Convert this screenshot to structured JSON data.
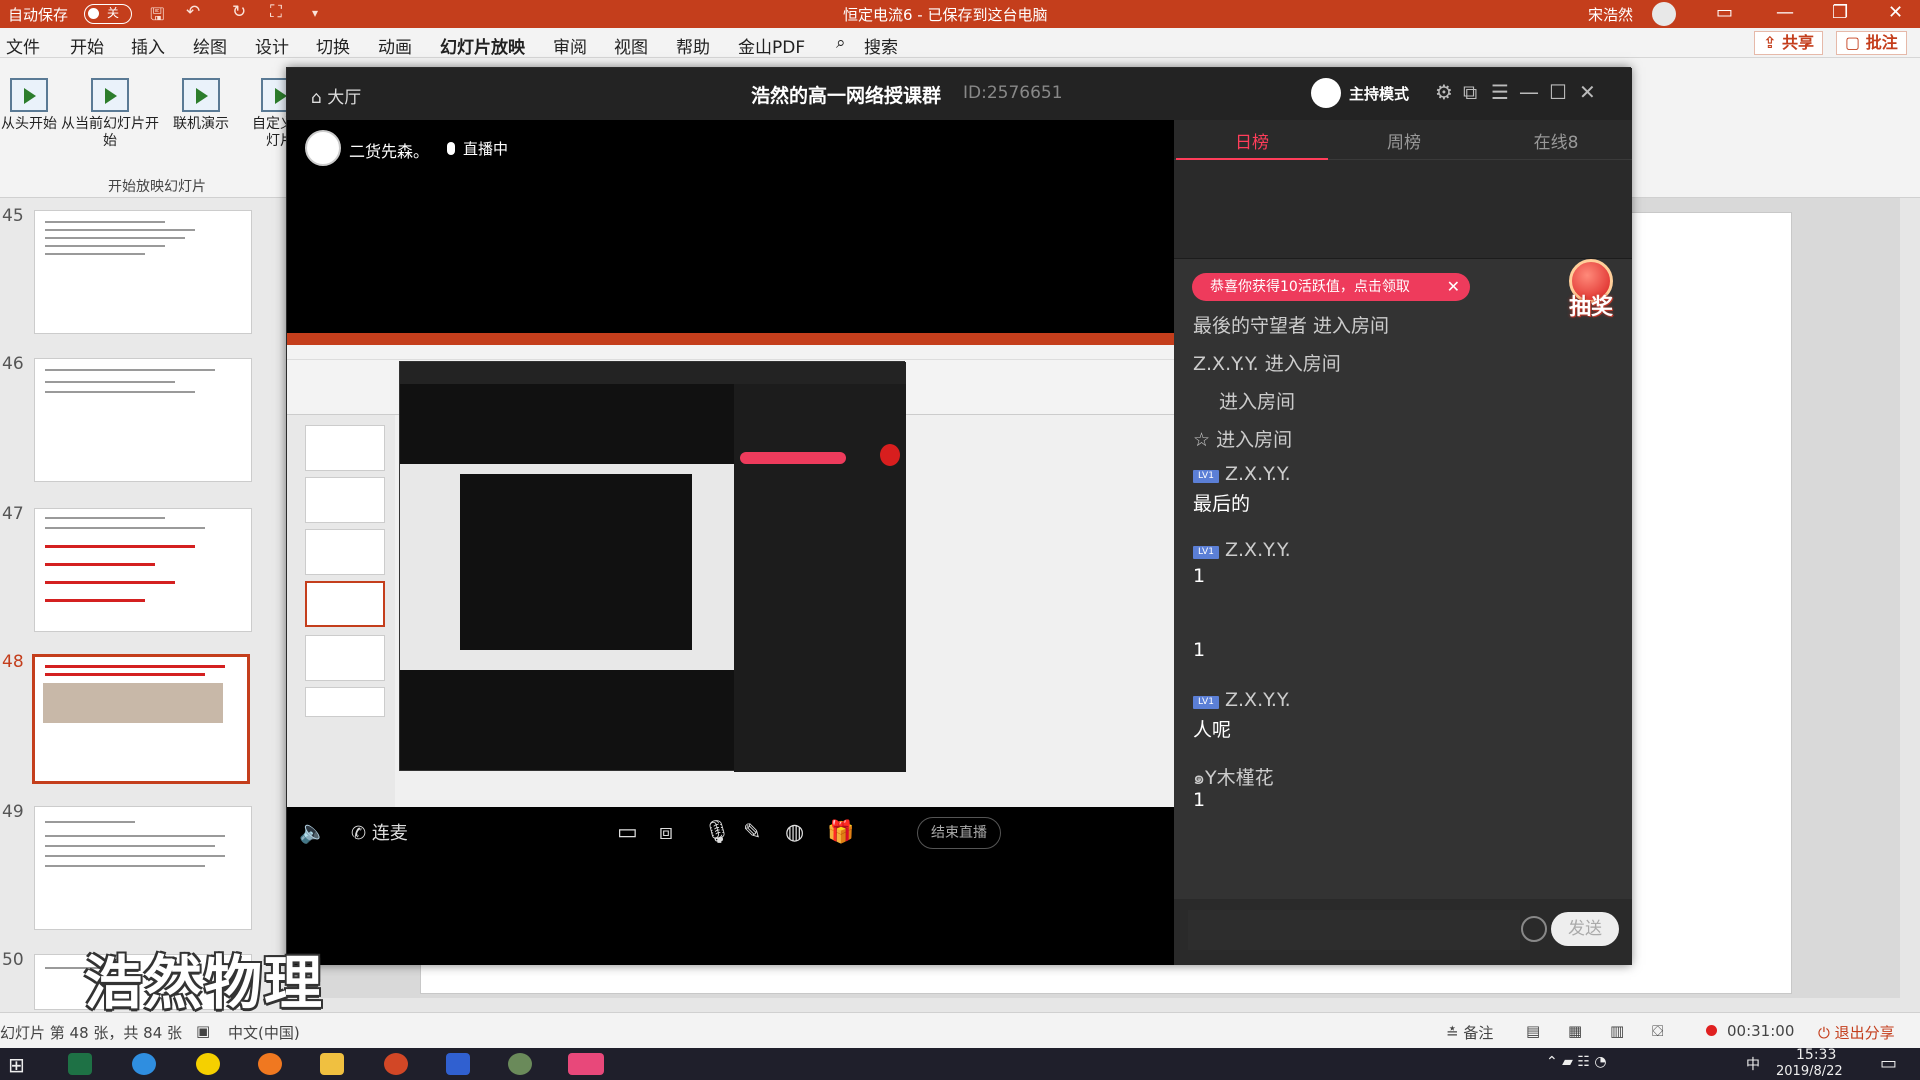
{
  "ppt": {
    "autosave_label": "自动保存",
    "autosave_state": "关",
    "window_title": "恒定电流6 - 已保存到这台电脑",
    "user_name": "宋浩然",
    "menu": [
      "文件",
      "开始",
      "插入",
      "绘图",
      "设计",
      "切换",
      "动画",
      "幻灯片放映",
      "审阅",
      "视图",
      "帮助",
      "金山PDF"
    ],
    "active_menu": "幻灯片放映",
    "search_label": "搜索",
    "share_label": "共享",
    "comment_label": "批注",
    "ribbon_buttons": [
      {
        "label": "从头开始"
      },
      {
        "label": "从当前幻灯片开始"
      },
      {
        "label": "联机演示"
      },
      {
        "label": "自定义幻灯片"
      }
    ],
    "ribbon_group_label": "开始放映幻灯片",
    "slide_numbers": [
      "45",
      "46",
      "47",
      "48",
      "49",
      "50"
    ],
    "current_slide": "48",
    "status": {
      "slide_info": "幻灯片 第 48 张，共 84 张",
      "language": "中文(中国)",
      "notes_label": "备注",
      "record_time": "00:31:00",
      "stop_share": "退出分享"
    }
  },
  "stream": {
    "lobby_label": "大厅",
    "title": "浩然的高一网络授课群",
    "room_id": "ID:2576651",
    "host_mode_label": "主持模式",
    "streamer_name": "二货先森。",
    "live_label": "直播中",
    "link_label": "连麦",
    "end_live_label": "结束直播",
    "tabs": [
      "日榜",
      "周榜",
      "在线8"
    ],
    "active_tab": "日榜",
    "notice_pill": "恭喜你获得10活跃值，点击领取",
    "lottery_label": "抽奖",
    "messages": [
      {
        "text": "最後的守望者 进入房间"
      },
      {
        "text": "Z.X.Y.Y. 进入房间"
      },
      {
        "text": "进入房间"
      },
      {
        "text": "☆ 进入房间"
      }
    ],
    "chats": [
      {
        "level": "LV1",
        "user": "Z.X.Y.Y.",
        "content": "最后的"
      },
      {
        "level": "LV1",
        "user": "Z.X.Y.Y.",
        "content": "1"
      },
      {
        "level": "",
        "user": "",
        "content": "1"
      },
      {
        "level": "LV1",
        "user": "Z.X.Y.Y.",
        "content": "人呢"
      },
      {
        "level": "",
        "user": "๑Y木槿花",
        "content": "1"
      }
    ],
    "send_label": "发送"
  },
  "watermark": "浩然物理",
  "taskbar": {
    "time": "15:33",
    "date": "2019/8/22",
    "ime": "中"
  },
  "accent_color": "#c43e1c",
  "pink_accent": "#ee3b5c"
}
